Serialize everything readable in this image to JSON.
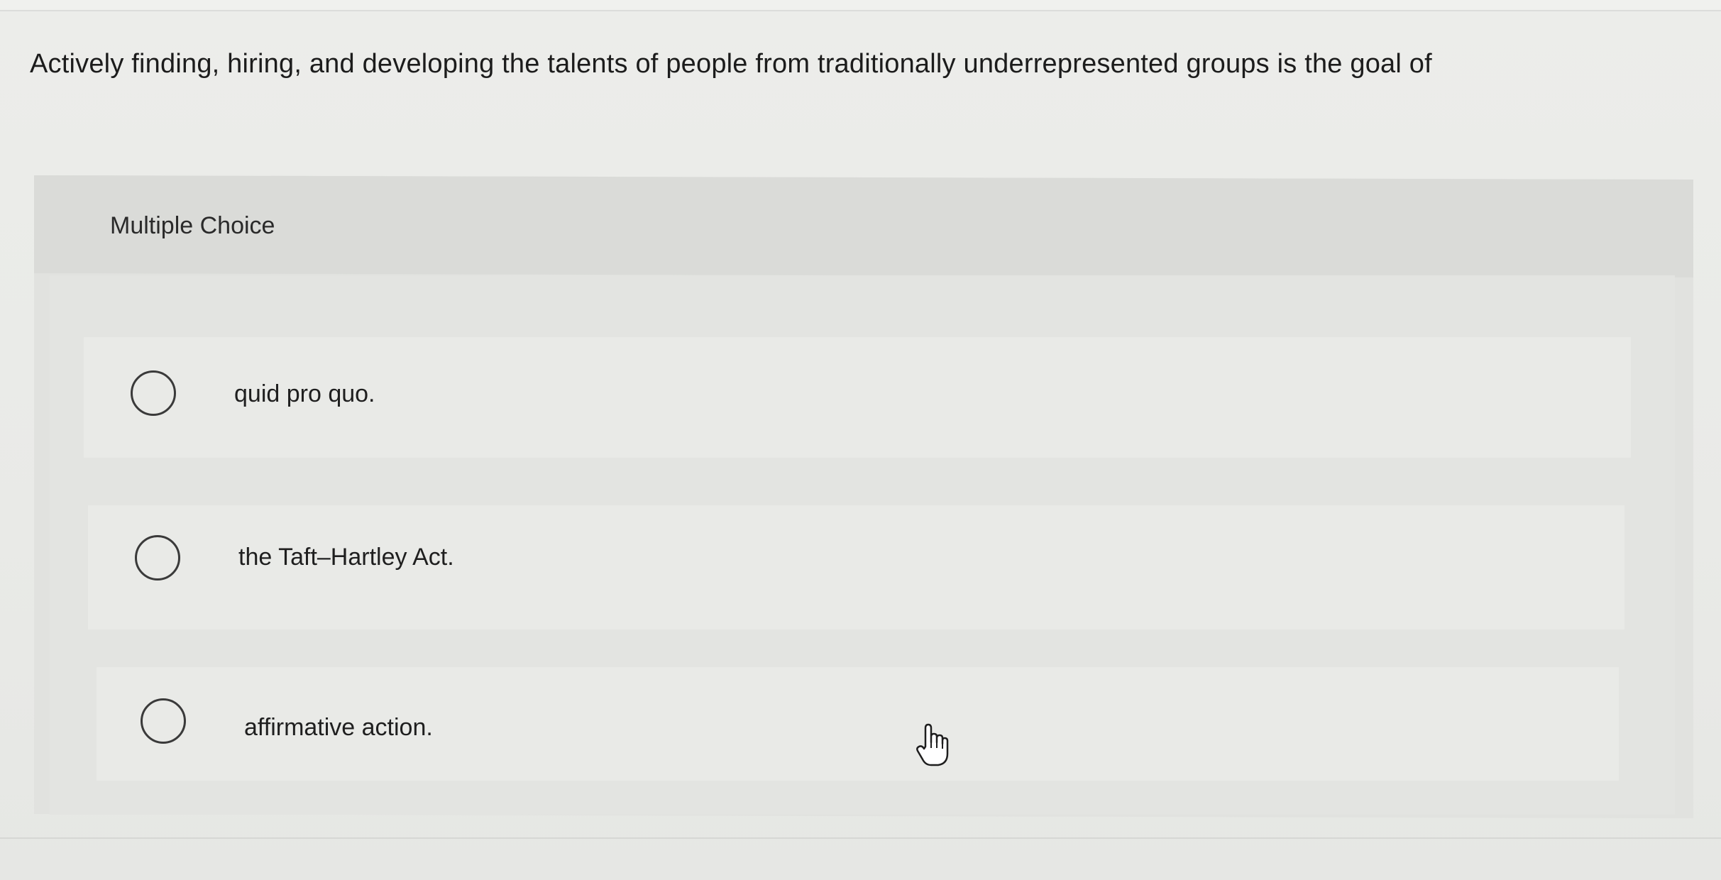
{
  "question": {
    "text": "Actively finding, hiring, and developing the talents of people from traditionally underrepresented groups is the goal of"
  },
  "multiple_choice": {
    "label": "Multiple Choice",
    "options": [
      {
        "label": "quid pro quo.",
        "selected": false
      },
      {
        "label": "the Taft–Hartley Act.",
        "selected": false
      },
      {
        "label": "affirmative action.",
        "selected": false
      }
    ]
  },
  "icons": {
    "radio": "radio-unselected-icon",
    "cursor": "hand-pointer-cursor-icon"
  }
}
